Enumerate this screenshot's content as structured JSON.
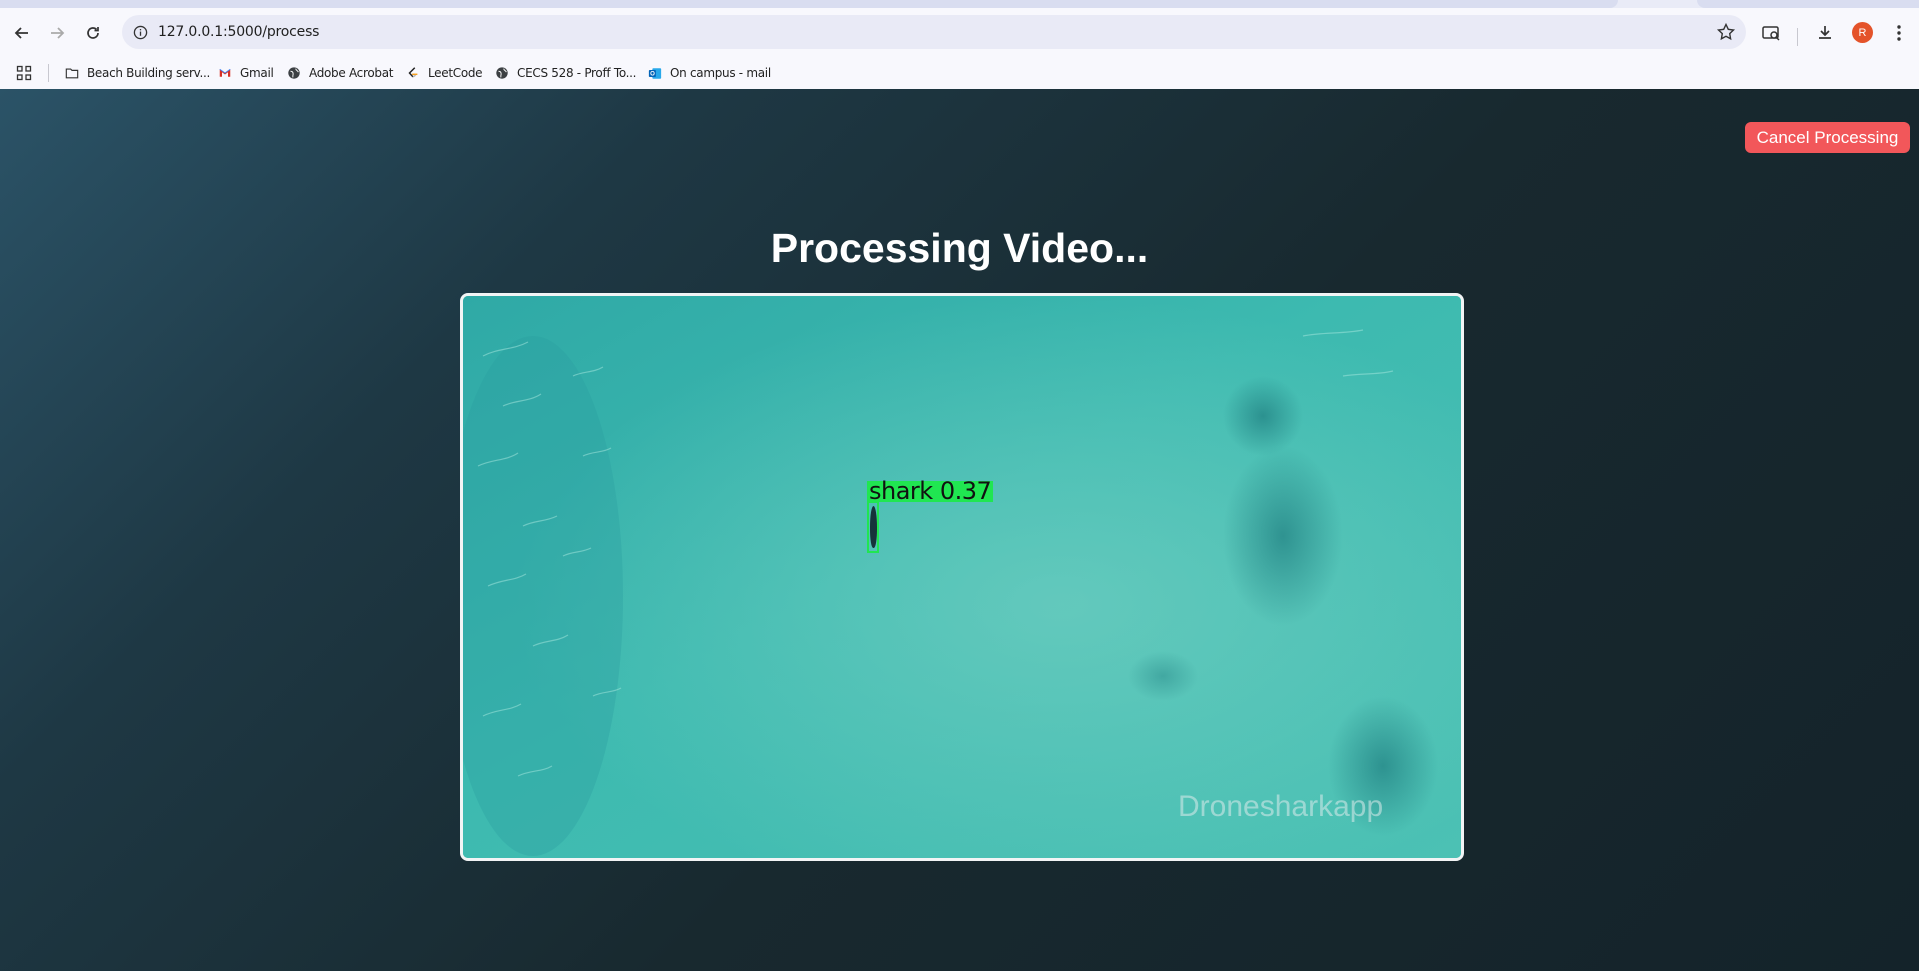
{
  "browser": {
    "url": "127.0.0.1:5000/process",
    "avatar_initial": "R",
    "bookmarks": [
      {
        "label": "Beach Building serv...",
        "icon": "folder-icon"
      },
      {
        "label": "Gmail",
        "icon": "gmail-icon"
      },
      {
        "label": "Adobe Acrobat",
        "icon": "globe-icon"
      },
      {
        "label": "LeetCode",
        "icon": "leetcode-icon"
      },
      {
        "label": "CECS 528 - Proff To...",
        "icon": "globe-icon"
      },
      {
        "label": "On campus - mail",
        "icon": "outlook-icon"
      }
    ]
  },
  "page": {
    "title": "Processing Video...",
    "cancel_label": "Cancel Processing",
    "detection": {
      "label": "shark  0.37",
      "class": "shark",
      "confidence": 0.37
    },
    "watermark": "Dronesharkapp"
  },
  "colors": {
    "cancel_button": "#f2575a",
    "detection_box": "#20e651",
    "water": "#3fb4ab"
  }
}
